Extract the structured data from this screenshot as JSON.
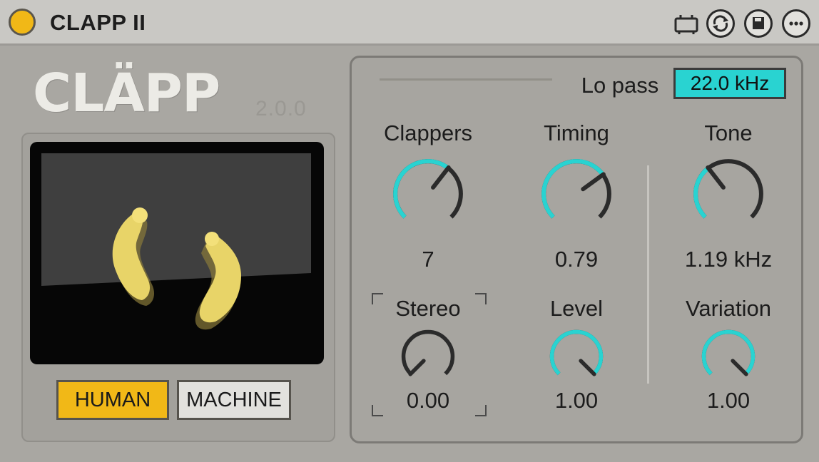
{
  "titlebar": {
    "title": "CLAPP II",
    "icons": [
      "power-toggle-icon",
      "mapping-icon",
      "swap-icon",
      "save-preset-icon",
      "more-options-icon"
    ]
  },
  "logo": {
    "text": "CLÄPP",
    "version": "2.0.0"
  },
  "modes": {
    "human_label": "HUMAN",
    "machine_label": "MACHINE",
    "active": "HUMAN"
  },
  "lopass": {
    "label": "Lo pass",
    "value": "22.0 kHz"
  },
  "knobs": {
    "clappers": {
      "label": "Clappers",
      "value": "7",
      "level": 0.64
    },
    "timing": {
      "label": "Timing",
      "value": "0.79",
      "level": 0.7
    },
    "tone": {
      "label": "Tone",
      "value": "1.19 kHz",
      "level": 0.36
    },
    "stereo": {
      "label": "Stereo",
      "value": "0.00",
      "level": 0.0
    },
    "level": {
      "label": "Level",
      "value": "1.00",
      "level": 1.0
    },
    "variation": {
      "label": "Variation",
      "value": "1.00",
      "level": 1.0
    }
  },
  "colors": {
    "accent": "#29d3d1",
    "power": "#f1b817",
    "human_active": "#f1b817",
    "machine_inactive": "#e2e1dd",
    "clap_yellow": "#e8d468",
    "knob_track": "#2b2b2b"
  }
}
